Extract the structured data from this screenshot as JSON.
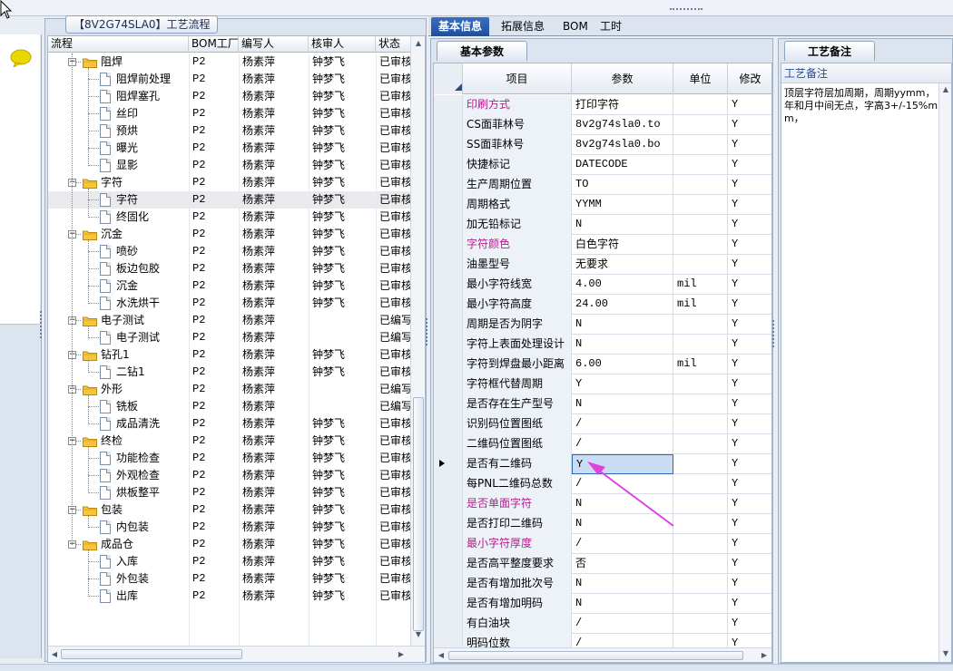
{
  "process_panel": {
    "title": "【8V2G74SLA0】工艺流程",
    "columns": [
      "流程",
      "BOM工厂",
      "编写人",
      "核审人",
      "状态"
    ],
    "rows": [
      {
        "level": 1,
        "type": "group",
        "expanded": true,
        "label": "阻焊",
        "factory": "P2",
        "writer": "杨素萍",
        "reviewer": "钟梦飞",
        "status": "已审核"
      },
      {
        "level": 2,
        "type": "item",
        "label": "阻焊前处理",
        "factory": "P2",
        "writer": "杨素萍",
        "reviewer": "钟梦飞",
        "status": "已审核"
      },
      {
        "level": 2,
        "type": "item",
        "label": "阻焊塞孔",
        "factory": "P2",
        "writer": "杨素萍",
        "reviewer": "钟梦飞",
        "status": "已审核"
      },
      {
        "level": 2,
        "type": "item",
        "label": "丝印",
        "factory": "P2",
        "writer": "杨素萍",
        "reviewer": "钟梦飞",
        "status": "已审核"
      },
      {
        "level": 2,
        "type": "item",
        "label": "预烘",
        "factory": "P2",
        "writer": "杨素萍",
        "reviewer": "钟梦飞",
        "status": "已审核"
      },
      {
        "level": 2,
        "type": "item",
        "label": "曝光",
        "factory": "P2",
        "writer": "杨素萍",
        "reviewer": "钟梦飞",
        "status": "已审核"
      },
      {
        "level": 2,
        "type": "item",
        "label": "显影",
        "factory": "P2",
        "writer": "杨素萍",
        "reviewer": "钟梦飞",
        "status": "已审核"
      },
      {
        "level": 1,
        "type": "group",
        "expanded": true,
        "label": "字符",
        "factory": "P2",
        "writer": "杨素萍",
        "reviewer": "钟梦飞",
        "status": "已审核"
      },
      {
        "level": 2,
        "type": "item",
        "label": "字符",
        "factory": "P2",
        "writer": "杨素萍",
        "reviewer": "钟梦飞",
        "status": "已审核",
        "selected": true
      },
      {
        "level": 2,
        "type": "item",
        "label": "终固化",
        "factory": "P2",
        "writer": "杨素萍",
        "reviewer": "钟梦飞",
        "status": "已审核"
      },
      {
        "level": 1,
        "type": "group",
        "expanded": true,
        "label": "沉金",
        "factory": "P2",
        "writer": "杨素萍",
        "reviewer": "钟梦飞",
        "status": "已审核"
      },
      {
        "level": 2,
        "type": "item",
        "label": "喷砂",
        "factory": "P2",
        "writer": "杨素萍",
        "reviewer": "钟梦飞",
        "status": "已审核"
      },
      {
        "level": 2,
        "type": "item",
        "label": "板边包胶",
        "factory": "P2",
        "writer": "杨素萍",
        "reviewer": "钟梦飞",
        "status": "已审核"
      },
      {
        "level": 2,
        "type": "item",
        "label": "沉金",
        "factory": "P2",
        "writer": "杨素萍",
        "reviewer": "钟梦飞",
        "status": "已审核"
      },
      {
        "level": 2,
        "type": "item",
        "label": "水洗烘干",
        "factory": "P2",
        "writer": "杨素萍",
        "reviewer": "钟梦飞",
        "status": "已审核"
      },
      {
        "level": 1,
        "type": "group",
        "expanded": true,
        "label": "电子测试",
        "factory": "P2",
        "writer": "杨素萍",
        "reviewer": "",
        "status": "已编写"
      },
      {
        "level": 2,
        "type": "item",
        "label": "电子测试",
        "factory": "P2",
        "writer": "杨素萍",
        "reviewer": "",
        "status": "已编写"
      },
      {
        "level": 1,
        "type": "group",
        "expanded": true,
        "label": "钻孔1",
        "factory": "P2",
        "writer": "杨素萍",
        "reviewer": "钟梦飞",
        "status": "已审核"
      },
      {
        "level": 2,
        "type": "item",
        "label": "二钻1",
        "factory": "P2",
        "writer": "杨素萍",
        "reviewer": "钟梦飞",
        "status": "已审核"
      },
      {
        "level": 1,
        "type": "group",
        "expanded": true,
        "label": "外形",
        "factory": "P2",
        "writer": "杨素萍",
        "reviewer": "",
        "status": "已编写"
      },
      {
        "level": 2,
        "type": "item",
        "label": "铣板",
        "factory": "P2",
        "writer": "杨素萍",
        "reviewer": "",
        "status": "已编写"
      },
      {
        "level": 2,
        "type": "item",
        "label": "成品清洗",
        "factory": "P2",
        "writer": "杨素萍",
        "reviewer": "钟梦飞",
        "status": "已审核"
      },
      {
        "level": 1,
        "type": "group",
        "expanded": true,
        "label": "终检",
        "factory": "P2",
        "writer": "杨素萍",
        "reviewer": "钟梦飞",
        "status": "已审核"
      },
      {
        "level": 2,
        "type": "item",
        "label": "功能检查",
        "factory": "P2",
        "writer": "杨素萍",
        "reviewer": "钟梦飞",
        "status": "已审核"
      },
      {
        "level": 2,
        "type": "item",
        "label": "外观检查",
        "factory": "P2",
        "writer": "杨素萍",
        "reviewer": "钟梦飞",
        "status": "已审核"
      },
      {
        "level": 2,
        "type": "item",
        "label": "烘板整平",
        "factory": "P2",
        "writer": "杨素萍",
        "reviewer": "钟梦飞",
        "status": "已审核"
      },
      {
        "level": 1,
        "type": "group",
        "expanded": true,
        "label": "包装",
        "factory": "P2",
        "writer": "杨素萍",
        "reviewer": "钟梦飞",
        "status": "已审核"
      },
      {
        "level": 2,
        "type": "item",
        "label": "内包装",
        "factory": "P2",
        "writer": "杨素萍",
        "reviewer": "钟梦飞",
        "status": "已审核"
      },
      {
        "level": 1,
        "type": "group",
        "expanded": true,
        "label": "成品仓",
        "factory": "P2",
        "writer": "杨素萍",
        "reviewer": "钟梦飞",
        "status": "已审核"
      },
      {
        "level": 2,
        "type": "item",
        "label": "入库",
        "factory": "P2",
        "writer": "杨素萍",
        "reviewer": "钟梦飞",
        "status": "已审核"
      },
      {
        "level": 2,
        "type": "item",
        "label": "外包装",
        "factory": "P2",
        "writer": "杨素萍",
        "reviewer": "钟梦飞",
        "status": "已审核"
      },
      {
        "level": 2,
        "type": "item",
        "label": "出库",
        "factory": "P2",
        "writer": "杨素萍",
        "reviewer": "钟梦飞",
        "status": "已审核"
      }
    ]
  },
  "main_tabs": [
    {
      "label": "基本信息",
      "active": true
    },
    {
      "label": "拓展信息",
      "active": false
    },
    {
      "label": "BOM",
      "active": false
    },
    {
      "label": "工时",
      "active": false
    }
  ],
  "params_panel": {
    "subtab": "基本参数",
    "columns": {
      "item": "项目",
      "param": "参数",
      "unit": "单位",
      "modify": "修改"
    },
    "rows": [
      {
        "item": "印刷方式",
        "param": "打印字符",
        "unit": "",
        "modify": "Y",
        "highlight": true
      },
      {
        "item": "CS面菲林号",
        "param": "8v2g74sla0.to",
        "unit": "",
        "modify": "Y"
      },
      {
        "item": "SS面菲林号",
        "param": "8v2g74sla0.bo",
        "unit": "",
        "modify": "Y"
      },
      {
        "item": "快捷标记",
        "param": "DATECODE",
        "unit": "",
        "modify": "Y"
      },
      {
        "item": "生产周期位置",
        "param": "TO",
        "unit": "",
        "modify": "Y"
      },
      {
        "item": "周期格式",
        "param": "YYMM",
        "unit": "",
        "modify": "Y"
      },
      {
        "item": "加无铅标记",
        "param": "N",
        "unit": "",
        "modify": "Y"
      },
      {
        "item": "字符颜色",
        "param": "白色字符",
        "unit": "",
        "modify": "Y",
        "highlight": true
      },
      {
        "item": "油墨型号",
        "param": "无要求",
        "unit": "",
        "modify": "Y"
      },
      {
        "item": "最小字符线宽",
        "param": "4.00",
        "unit": "mil",
        "modify": "Y"
      },
      {
        "item": "最小字符高度",
        "param": "24.00",
        "unit": "mil",
        "modify": "Y"
      },
      {
        "item": "周期是否为阴字",
        "param": "N",
        "unit": "",
        "modify": "Y"
      },
      {
        "item": "字符上表面处理设计",
        "param": "N",
        "unit": "",
        "modify": "Y"
      },
      {
        "item": "字符到焊盘最小距离",
        "param": "6.00",
        "unit": "mil",
        "modify": "Y"
      },
      {
        "item": "字符框代替周期",
        "param": "Y",
        "unit": "",
        "modify": "Y"
      },
      {
        "item": "是否存在生产型号",
        "param": "N",
        "unit": "",
        "modify": "Y"
      },
      {
        "item": "识别码位置图纸",
        "param": "/",
        "unit": "",
        "modify": "Y"
      },
      {
        "item": "二维码位置图纸",
        "param": "/",
        "unit": "",
        "modify": "Y"
      },
      {
        "item": "是否有二维码",
        "param": "Y",
        "unit": "",
        "modify": "Y",
        "current": true
      },
      {
        "item": "每PNL二维码总数",
        "param": "/",
        "unit": "",
        "modify": "Y"
      },
      {
        "item": "是否单面字符",
        "param": "N",
        "unit": "",
        "modify": "Y",
        "highlight": true
      },
      {
        "item": "是否打印二维码",
        "param": "N",
        "unit": "",
        "modify": "Y"
      },
      {
        "item": "最小字符厚度",
        "param": "/",
        "unit": "",
        "modify": "Y",
        "highlight": true
      },
      {
        "item": "是否高平整度要求",
        "param": "否",
        "unit": "",
        "modify": "Y"
      },
      {
        "item": "是否有增加批次号",
        "param": "N",
        "unit": "",
        "modify": "Y"
      },
      {
        "item": "是否有增加明码",
        "param": "N",
        "unit": "",
        "modify": "Y"
      },
      {
        "item": "有白油块",
        "param": "/",
        "unit": "",
        "modify": "Y"
      },
      {
        "item": "明码位数",
        "param": "/",
        "unit": "",
        "modify": "Y"
      }
    ]
  },
  "remark_panel": {
    "tab": "工艺备注",
    "label": "工艺备注",
    "text": "顶层字符层加周期，周期yymm，年和月中间无点，字高3+/-15%mm，"
  },
  "colors": {
    "highlight_text": "#b0208c",
    "active_tab": "#1d4f9e",
    "annotation_arrow": "#e040e0"
  },
  "icons": [
    "cursor-icon",
    "chat-icon",
    "folder-icon",
    "doc-icon",
    "expander-icon"
  ]
}
